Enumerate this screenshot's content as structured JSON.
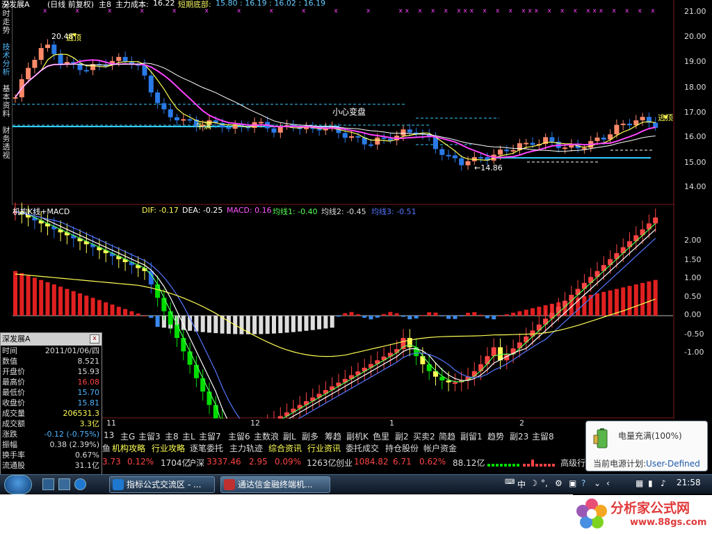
{
  "price_panel": {
    "title": "深发展A",
    "mode": "(日线 前复权)",
    "main_label": "主8",
    "cost_label": "主力成本:",
    "cost_value": "16.22",
    "bottom_label": "短期底部:",
    "bottom_values": "15.80 : 16.19 : 16.02 : 16.19",
    "annotations": [
      "20.48",
      "逃顶",
      "逃顶",
      "小心变盘",
      "牛满",
      "←14.86"
    ]
  },
  "left_tabs": [
    "分时走势",
    "技术分析",
    "基本资料",
    "财务透视"
  ],
  "indicator_panel": {
    "title": "机构K线+MACD",
    "dif": "DIF: -0.17",
    "dea": "DEA: -0.25",
    "macd": "MACD: 0.16",
    "ma1": "均线1: -0.40",
    "ma2": "均线2: -0.45",
    "ma3": "均线3: -0.51"
  },
  "price_axis": [
    "21.00",
    "20.00",
    "19.00",
    "18.00",
    "17.00",
    "16.00",
    "15.00",
    "14.00"
  ],
  "macd_axis": [
    "2.00",
    "1.50",
    "1.00",
    "0.50",
    "0.00",
    "-0.50",
    "-1.00"
  ],
  "date_axis": [
    "11",
    "12",
    "1",
    "2"
  ],
  "popup": {
    "title": "深发展A",
    "close": "x",
    "rows": [
      {
        "k": "时间",
        "v": "2011/01/06/四"
      },
      {
        "k": "数值",
        "v": "8.521"
      },
      {
        "k": "开盘价",
        "v": "15.93"
      },
      {
        "k": "最高价",
        "v": "16.08"
      },
      {
        "k": "最低价",
        "v": "15.70"
      },
      {
        "k": "收盘价",
        "v": "15.81"
      },
      {
        "k": "成交量",
        "v": "206531.3"
      },
      {
        "k": "成交额",
        "v": "3.3亿"
      },
      {
        "k": "涨跌",
        "v": "-0.12 (-0.75%)"
      },
      {
        "k": "振幅",
        "v": "0.38 (2.39%)"
      },
      {
        "k": "换手率",
        "v": "0.67%"
      },
      {
        "k": "流通股",
        "v": "31.1亿"
      }
    ]
  },
  "menu_row1": [
    "13",
    "主G",
    "主留3",
    "主8",
    "主L",
    "主留7",
    "主留6",
    "主数浪",
    "副L",
    "副多",
    "筹趋",
    "副机K",
    "色里",
    "副2",
    "买卖2",
    "简趋",
    "副留1",
    "趋势",
    "副23",
    "主留8"
  ],
  "menu_row2": [
    "鱼",
    "机构攻略",
    "行业攻略",
    "逐笔委托",
    "主力轨迹",
    "综合资讯",
    "行业资讯",
    "委托成交",
    "持仓股份",
    "帐户资金"
  ],
  "ticker": {
    "a1": "3.73",
    "a2": "0.12%",
    "a3": "1704亿",
    "hs_label": "沪深",
    "hs_val": "3337.46",
    "hs_chg": "2.95",
    "hs_pct": "0.09%",
    "hs_amt": "1263亿",
    "cy_label": "创业",
    "cy_val": "1084.82",
    "cy_chg": "6.71",
    "cy_pct": "0.62%",
    "cy_amt": "88.12亿",
    "more": "高级行"
  },
  "balloon": {
    "line1": "电量充满(100%)",
    "line2_label": "当前电源计划:",
    "line2_value": "User-Defined"
  },
  "taskbar": {
    "task1": "指标公式交流区 - ...",
    "task2": "通达信金融终端机...",
    "ime": "中",
    "clock": "21:58"
  },
  "watermark": {
    "line1": "分析家公式网",
    "line2": "www.88gs.com"
  },
  "colors": {
    "up": "#ff5a5a",
    "down": "#2a6ee8",
    "yellow": "#ffff55",
    "cyan": "#33ccff",
    "magenta": "#ff44ff",
    "green": "#00dd00"
  }
}
